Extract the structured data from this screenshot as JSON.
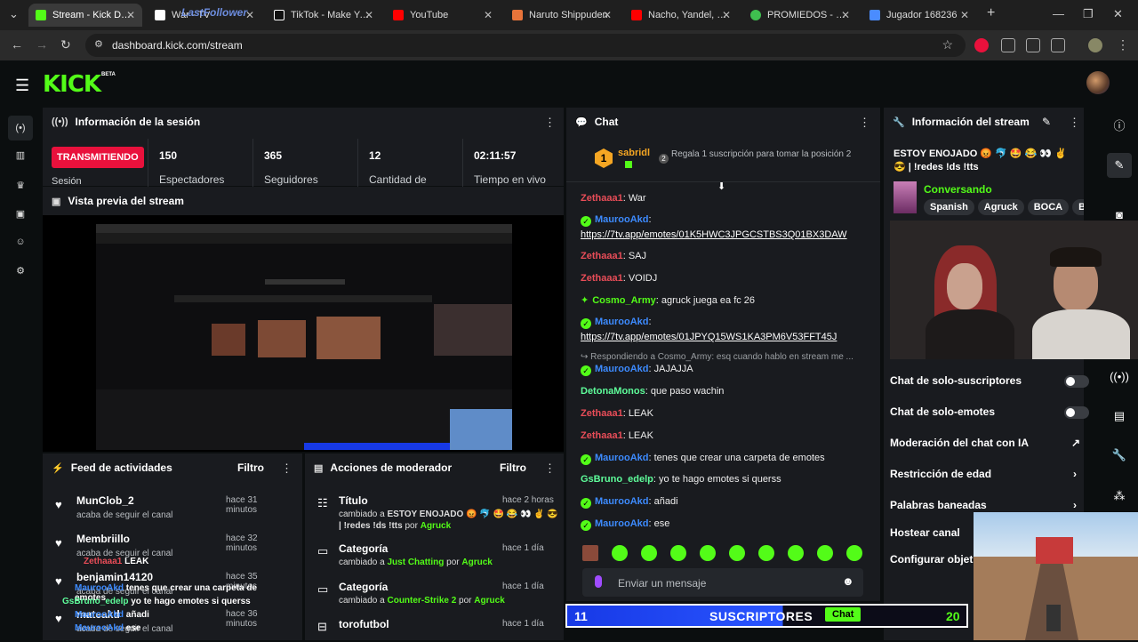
{
  "browser": {
    "tabs": [
      {
        "title": "Stream - Kick Dash",
        "active": true,
        "color": "#53fc18"
      },
      {
        "title": "War - TV",
        "active": false,
        "color": "#ffffff"
      },
      {
        "title": "TikTok - Make Your",
        "active": false,
        "color": "#ffffff"
      },
      {
        "title": "YouTube",
        "active": false,
        "color": "#ff0000"
      },
      {
        "title": "Naruto Shippuden",
        "active": false,
        "color": "#e8743a"
      },
      {
        "title": "Nacho, Yandel, Ba",
        "active": false,
        "color": "#ff0000"
      },
      {
        "title": "PROMIEDOS - Fut",
        "active": false,
        "color": "#3fbf4f"
      },
      {
        "title": "Jugador 168236",
        "active": false,
        "color": "#4a8cff"
      }
    ],
    "url": "dashboard.kick.com/stream",
    "overlay_label": "LastFollower"
  },
  "app": {
    "logo": "KICK",
    "beta": "BETA"
  },
  "session": {
    "title": "Información de la sesión",
    "live_label": "TRANSMITIENDO",
    "session_label": "Sesión",
    "stats": [
      {
        "value": "150",
        "label": "Espectadores"
      },
      {
        "value": "365",
        "label": "Seguidores"
      },
      {
        "value": "12",
        "label": "Cantidad de"
      },
      {
        "value": "02:11:57",
        "label": "Tiempo en vivo"
      }
    ]
  },
  "preview": {
    "title": "Vista previa del stream"
  },
  "activity": {
    "title": "Feed de actividades",
    "filter": "Filtro",
    "items": [
      {
        "user": "MunClob_2",
        "action": "acaba de seguir el canal",
        "time": "hace 31 minutos"
      },
      {
        "user": "Membriillo",
        "action": "acaba de seguir el canal",
        "time": "hace 32 minutos"
      },
      {
        "user": "benjamin14120",
        "action": "acaba de seguir el canal",
        "time": "hace 35 minutos"
      },
      {
        "user": "mateakd",
        "action": "acaba de seguir el canal",
        "time": "hace 36 minutos"
      }
    ]
  },
  "modactions": {
    "title": "Acciones de moderador",
    "filter": "Filtro",
    "items": [
      {
        "type": "Título",
        "time": "hace 2 horas",
        "prefix": "cambiado a ",
        "value": "ESTOY ENOJADO 😡 🐬 🤩 😂 👀 ✌ 😎 | !redes !ds !tts",
        "by": " por ",
        "user": "Agruck"
      },
      {
        "type": "Categoría",
        "time": "hace 1 día",
        "prefix": "cambiado a ",
        "value": "Just Chatting",
        "by": " por ",
        "user": "Agruck"
      },
      {
        "type": "Categoría",
        "time": "hace 1 día",
        "prefix": "cambiado a ",
        "value": "Counter-Strike 2",
        "by": " por ",
        "user": "Agruck"
      },
      {
        "type": "torofutbol",
        "time": "hace 1 día",
        "prefix": "",
        "value": "",
        "by": "",
        "user": ""
      }
    ]
  },
  "chat": {
    "title": "Chat",
    "pinned_user": "sabridl",
    "pinned_rank": "1",
    "gift_text": "Regala 1 suscripción para tomar la posición 2",
    "gift_num": "2",
    "messages": [
      {
        "user": "Zethaaa1",
        "text": ": War",
        "color": "red"
      },
      {
        "user": "MauroоAkd",
        "text": ":",
        "color": "blue",
        "badge": true,
        "link": "https://7tv.app/emotes/01K5HWC3JPGCSTBS3Q01BX3DAW"
      },
      {
        "user": "Zethaaa1",
        "text": ": SAJ",
        "color": "red"
      },
      {
        "user": "Zethaaa1",
        "text": ": VOIDJ",
        "color": "red"
      },
      {
        "user": "Cosmo_Army",
        "text": ": agruck juega ea fc 26",
        "color": "green",
        "star": true
      },
      {
        "user": "MauroоAkd",
        "text": ":",
        "color": "blue",
        "badge": true,
        "link": "https://7tv.app/emotes/01JPYQ15WS1KA3PM6V53FFT45J"
      },
      {
        "reply": "Respondiendo a Cosmo_Army: esq cuando hablo en stream me ..."
      },
      {
        "user": "MauroоAkd",
        "text": ": JAJAJJA",
        "color": "blue",
        "badge": true
      },
      {
        "user": "DetonaMonos",
        "text": ": que paso wachin",
        "color": "lgreen"
      },
      {
        "user": "Zethaaa1",
        "text": ": LEAK",
        "color": "red"
      },
      {
        "user": "Zethaaa1",
        "text": ": LEAK",
        "color": "red"
      },
      {
        "user": "MauroоAkd",
        "text": ": tenes que crear una carpeta de emotes",
        "color": "blue",
        "badge": true
      },
      {
        "user": "GsBruno_edelp",
        "text": ": yo te hago emotes si querss",
        "color": "lgreen"
      },
      {
        "user": "MauroоAkd",
        "text": ": añadi",
        "color": "blue",
        "badge": true
      },
      {
        "user": "MauroоAkd",
        "text": ": ese",
        "color": "blue",
        "badge": true
      }
    ],
    "input_placeholder": "Enviar un mensaje"
  },
  "streaminfo": {
    "title": "Información del stream",
    "stream_title": "ESTOY ENOJADO 😡 🐬 🤩 😂 👀 ✌ 😎 | !redes !ds !tts",
    "category": "Conversando",
    "tags": [
      "Spanish",
      "Agruck",
      "BOCA",
      "BO"
    ],
    "settings": [
      {
        "label": "Chat de solo-suscriptores",
        "kind": "toggle"
      },
      {
        "label": "Chat de solo-emotes",
        "kind": "toggle"
      },
      {
        "label": "Moderación del chat con IA",
        "kind": "external"
      },
      {
        "label": "Restricción de edad",
        "kind": "chevron"
      },
      {
        "label": "Palabras baneadas",
        "kind": "chevron"
      },
      {
        "label": "Hostear canal",
        "kind": "none"
      },
      {
        "label": "Configurar objeti",
        "kind": "none"
      }
    ]
  },
  "overlay": {
    "subs_left": "11",
    "subs_label": "SUSCRIPTORES",
    "subs_chat": "Chat",
    "subs_right": "20",
    "lines": [
      {
        "user": "Zethaaa1",
        "text": "LEAK"
      },
      {
        "user": "MauroоAkd",
        "text": "tenes que crear una carpeta de emotes"
      },
      {
        "user": "GsBruno_edelp",
        "text": "yo te hago emotes si querss"
      },
      {
        "user": "MauroоAkd",
        "text": "añadi"
      },
      {
        "user": "MauroоAkd",
        "text": "ese"
      }
    ]
  },
  "colors": {
    "accent": "#53fc18",
    "live": "#e9113c",
    "panel": "#191b1f"
  }
}
